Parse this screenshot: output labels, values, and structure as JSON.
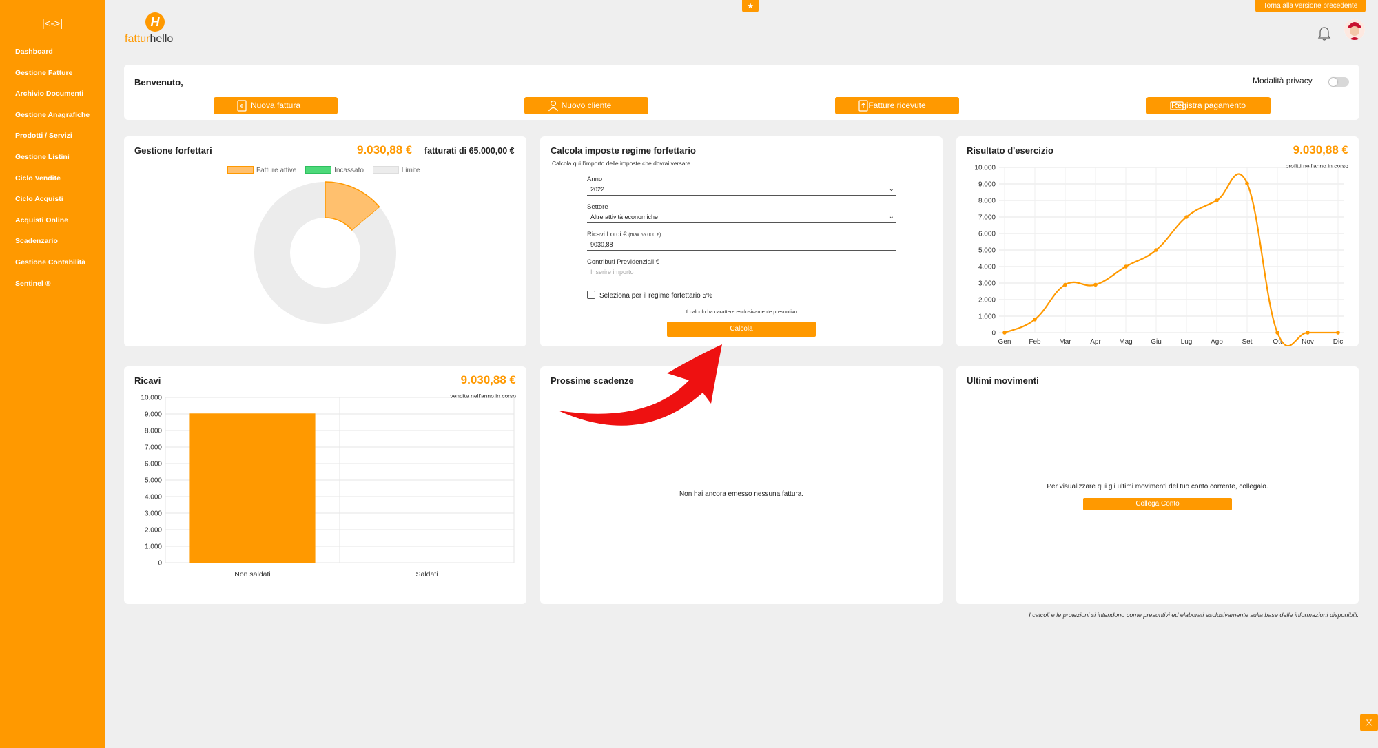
{
  "colors": {
    "accent": "#ff9900",
    "donut_limit": "#ececec",
    "donut_active": "#ffc06e",
    "incassato": "#4dd97a",
    "arrow": "#ee1111"
  },
  "sidebar": {
    "collapse_label": "|<->|",
    "items": [
      {
        "label": "Dashboard"
      },
      {
        "label": "Gestione Fatture"
      },
      {
        "label": "Archivio Documenti"
      },
      {
        "label": "Gestione Anagrafiche"
      },
      {
        "label": "Prodotti / Servizi"
      },
      {
        "label": "Gestione Listini"
      },
      {
        "label": "Ciclo Vendite"
      },
      {
        "label": "Ciclo Acquisti"
      },
      {
        "label": "Acquisti Online"
      },
      {
        "label": "Scadenzario"
      },
      {
        "label": "Gestione Contabilità"
      },
      {
        "label": "Sentinel ®"
      }
    ]
  },
  "header": {
    "logo_prefix": "fattur",
    "logo_suffix": "hello",
    "logo_mark": "H",
    "back_button": "Torna alla versione precedente",
    "icons": [
      "star-icon",
      "bell-icon",
      "avatar"
    ]
  },
  "welcome": {
    "title": "Benvenuto,",
    "privacy_label": "Modalità privacy",
    "privacy_on": false,
    "actions": [
      {
        "label": "Nuova fattura",
        "icon": "invoice-euro-icon"
      },
      {
        "label": "Nuovo cliente",
        "icon": "user-icon"
      },
      {
        "label": "Fatture ricevute",
        "icon": "upload-doc-icon"
      },
      {
        "label": "Registra pagamento",
        "icon": "money-icon"
      }
    ]
  },
  "forfettari": {
    "title": "Gestione forfettari",
    "value": "9.030,88 €",
    "subtitle": "fatturati di 65.000,00 €",
    "legend": [
      "Fatture attive",
      "Incassato",
      "Limite"
    ]
  },
  "calcola": {
    "title": "Calcola imposte regime forfettario",
    "subtitle": "Calcola qui l'importo delle imposte che dovrai versare",
    "anno_label": "Anno",
    "anno_value": "2022",
    "settore_label": "Settore",
    "settore_value": "Altre attività economiche",
    "ricavi_label": "Ricavi Lordi €",
    "ricavi_hint": "(max 65.000 €)",
    "ricavi_value": "9030,88",
    "contributi_label": "Contributi Previdenziali €",
    "contributi_placeholder": "Inserire importo",
    "checkbox_label": "Seleziona per il regime forfettario 5%",
    "checkbox_checked": false,
    "note": "Il calcolo ha carattere esclusivamente presuntivo",
    "button": "Calcola"
  },
  "risultato": {
    "title": "Risultato d'esercizio",
    "value": "9.030,88 €",
    "note": "profitti nell'anno in corso"
  },
  "ricavi": {
    "title": "Ricavi",
    "value": "9.030,88 €",
    "note": "vendite nell'anno in corso"
  },
  "scadenze": {
    "title": "Prossime scadenze",
    "empty": "Non hai ancora emesso nessuna fattura."
  },
  "movimenti": {
    "title": "Ultimi movimenti",
    "message": "Per visualizzare qui gli ultimi movimenti del tuo conto corrente, collegalo.",
    "button": "Collega Conto"
  },
  "footer": {
    "disclaimer": "I calcoli e le proiezioni si intendono come presuntivi ed elaborati esclusivamente sulla base delle informazioni disponibili."
  },
  "chart_data": [
    {
      "type": "pie",
      "variant": "doughnut",
      "labels": [
        "Fatture attive",
        "Incassato",
        "Limite"
      ],
      "values": [
        9030.88,
        0,
        55969.12
      ],
      "total": 65000
    },
    {
      "type": "line",
      "categories": [
        "Gen",
        "Feb",
        "Mar",
        "Apr",
        "Mag",
        "Giu",
        "Lug",
        "Ago",
        "Set",
        "Ott",
        "Nov",
        "Dic"
      ],
      "values": [
        0,
        800,
        2900,
        2900,
        4000,
        5000,
        7000,
        8000,
        9030.88,
        0,
        0,
        0
      ],
      "ylim": [
        0,
        10000
      ],
      "yticks": [
        "0",
        "1.000",
        "2.000",
        "3.000",
        "4.000",
        "5.000",
        "6.000",
        "7.000",
        "8.000",
        "9.000",
        "10.000"
      ],
      "grid": true
    },
    {
      "type": "bar",
      "categories": [
        "Non saldati",
        "Saldati"
      ],
      "values": [
        9030.88,
        0
      ],
      "ylim": [
        0,
        10000
      ],
      "yticks": [
        "0",
        "1.000",
        "2.000",
        "3.000",
        "4.000",
        "5.000",
        "6.000",
        "7.000",
        "8.000",
        "9.000",
        "10.000"
      ],
      "grid": true
    }
  ]
}
